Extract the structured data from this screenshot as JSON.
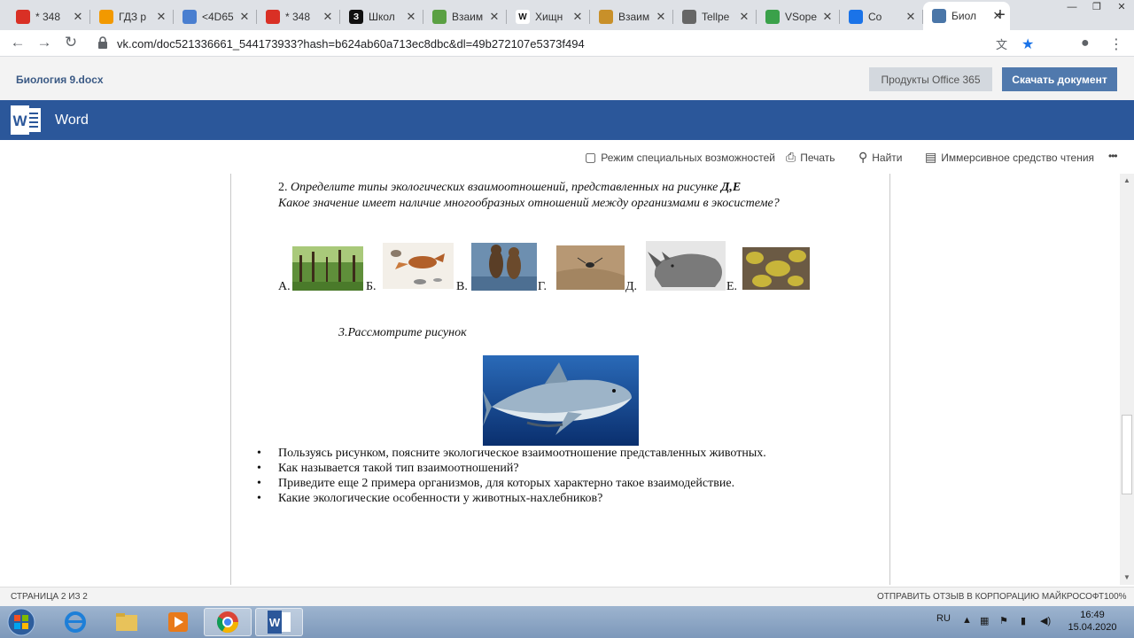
{
  "browser": {
    "tabs": [
      {
        "title": "* 348",
        "fav_color": "#d93025",
        "fav_char": "",
        "left": 0
      },
      {
        "title": "ГДЗ р",
        "fav_color": "#f29900",
        "fav_char": "",
        "left": 0
      },
      {
        "title": "<4D65",
        "fav_color": "#4a7fd0",
        "fav_char": "",
        "left": 0
      },
      {
        "title": "* 348",
        "fav_color": "#d93025",
        "fav_char": "",
        "left": 0
      },
      {
        "title": "Школ",
        "fav_color": "#111111",
        "fav_char": "З",
        "left": 0
      },
      {
        "title": "Взаим",
        "fav_color": "#5aa043",
        "fav_char": "",
        "left": 0
      },
      {
        "title": "Хищн",
        "fav_color": "#ffffff",
        "fav_char": "W",
        "left": 0
      },
      {
        "title": "Взаим",
        "fav_color": "#c8902a",
        "fav_char": "",
        "left": 0
      },
      {
        "title": "Tellpe",
        "fav_color": "#666666",
        "fav_char": "",
        "left": 0
      },
      {
        "title": "VSope",
        "fav_color": "#3aa14a",
        "fav_char": "",
        "left": 0
      },
      {
        "title": "Co",
        "fav_color": "#1a73e8",
        "fav_char": "",
        "left": 0
      },
      {
        "title": "Биол",
        "fav_color": "#4a76a8",
        "fav_char": "",
        "left": 0
      }
    ],
    "url": "vk.com/doc521336661_544173933?hash=b624ab60a713ec8dbc&dl=49b272107e5373f494"
  },
  "word": {
    "doc_name": "Биология 9.docx",
    "office_button": "Продукты Office 365",
    "download_button": "Скачать документ",
    "app_name": "Word",
    "commands": {
      "accessibility": "Режим специальных возможностей",
      "print": "Печать",
      "find": "Найти",
      "reader": "Иммерсивное средство чтения",
      "more": "•••"
    }
  },
  "document": {
    "q2_num": "2. ",
    "q2_line1": "Определите типы экологических взаимоотношений, представленных на рисунке ",
    "q2_bold": "Д,Е",
    "q2_line2": "Какое значение имеет наличие многообразных отношений между организмами в экосистеме?",
    "image_labels": [
      "А.",
      "Б.",
      "В.",
      "Г.",
      "Д.",
      "Е."
    ],
    "q3_title": "3.Рассмотрите рисунок",
    "bullets": [
      "Пользуясь рисунком, поясните экологическое взаимоотношение представленных животных.",
      "Как называется такой тип взаимоотношений?",
      "Приведите еще 2 примера организмов, для которых характерно такое взаимодействие.",
      "Какие экологические особенности у животных-нахлебников?"
    ]
  },
  "status": {
    "page": "СТРАНИЦА 2 ИЗ 2",
    "feedback": "ОТПРАВИТЬ ОТЗЫВ В КОРПОРАЦИЮ МАЙКРОСОФТ",
    "zoom": "100%"
  },
  "taskbar": {
    "lang": "RU",
    "time": "16:49",
    "date": "15.04.2020"
  }
}
